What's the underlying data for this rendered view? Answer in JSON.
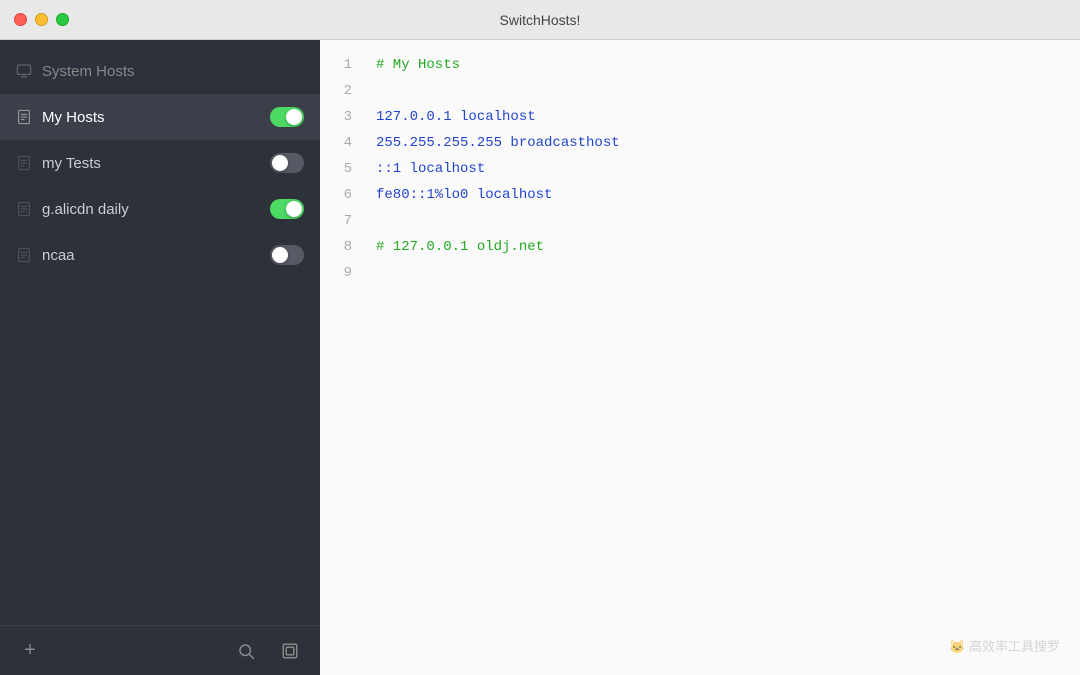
{
  "window": {
    "title": "SwitchHosts!"
  },
  "sidebar": {
    "system_hosts": {
      "label": "System Hosts",
      "icon": "monitor-icon"
    },
    "items": [
      {
        "id": "my-hosts",
        "label": "My Hosts",
        "active": true,
        "toggle": "on",
        "icon": "file-icon"
      },
      {
        "id": "my-tests",
        "label": "my Tests",
        "active": false,
        "toggle": "off",
        "icon": "file-icon"
      },
      {
        "id": "g-alicdn-daily",
        "label": "g.alicdn daily",
        "active": false,
        "toggle": "on",
        "icon": "file-icon"
      },
      {
        "id": "ncaa",
        "label": "ncaa",
        "active": false,
        "toggle": "off",
        "icon": "file-icon"
      }
    ],
    "footer": {
      "add_label": "+",
      "search_icon": "search-icon",
      "settings_icon": "settings-icon"
    }
  },
  "editor": {
    "lines": [
      {
        "num": 1,
        "text": "# My Hosts",
        "color": "green"
      },
      {
        "num": 2,
        "text": "",
        "color": "dark"
      },
      {
        "num": 3,
        "text": "127.0.0.1 localhost",
        "color": "blue"
      },
      {
        "num": 4,
        "text": "255.255.255.255 broadcasthost",
        "color": "blue"
      },
      {
        "num": 5,
        "text": "::1 localhost",
        "color": "blue"
      },
      {
        "num": 6,
        "text": "fe80::1%lo0 localhost",
        "color": "blue"
      },
      {
        "num": 7,
        "text": "",
        "color": "dark"
      },
      {
        "num": 8,
        "text": "# 127.0.0.1 oldj.net",
        "color": "green"
      },
      {
        "num": 9,
        "text": "",
        "color": "dark"
      }
    ]
  },
  "watermark": {
    "text": "🐱 高效率工具搜罗"
  }
}
